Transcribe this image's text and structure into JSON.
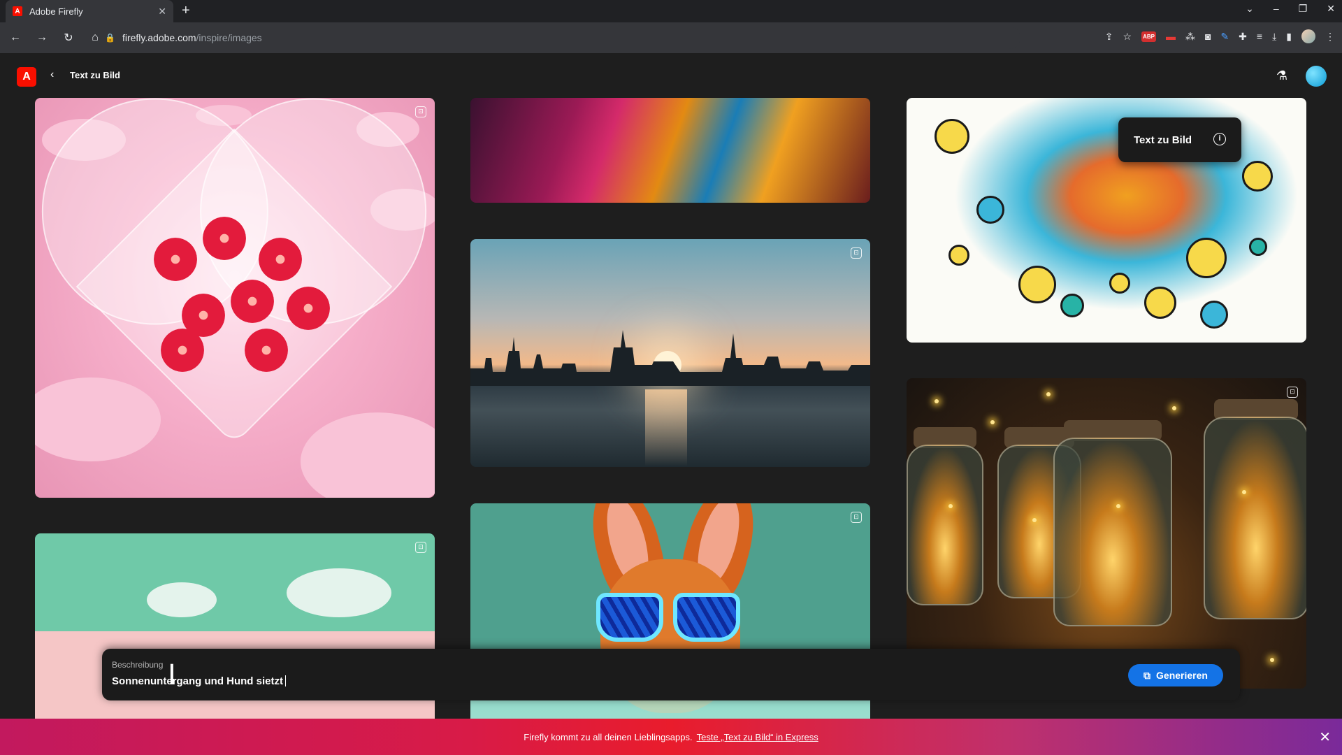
{
  "browser": {
    "tab_title": "Adobe Firefly",
    "favicon_letter": "A",
    "url_host": "firefly.adobe.com",
    "url_path": "/inspire/images",
    "abp_label": "ABP"
  },
  "header": {
    "title": "Text zu Bild",
    "logo_letter": "A"
  },
  "tooltip": {
    "label": "Text zu Bild"
  },
  "prompt": {
    "label": "Beschreibung",
    "value": "Sonnenuntergang und Hund sietzt",
    "button_label": "Generieren"
  },
  "banner": {
    "text": "Firefly kommt zu all deinen Lieblingsapps.",
    "link": "Teste „Text zu Bild“ in Express"
  },
  "colors": {
    "accent": "#1473e6",
    "adobe_red": "#fa0f00",
    "background": "#1e1e1e"
  }
}
